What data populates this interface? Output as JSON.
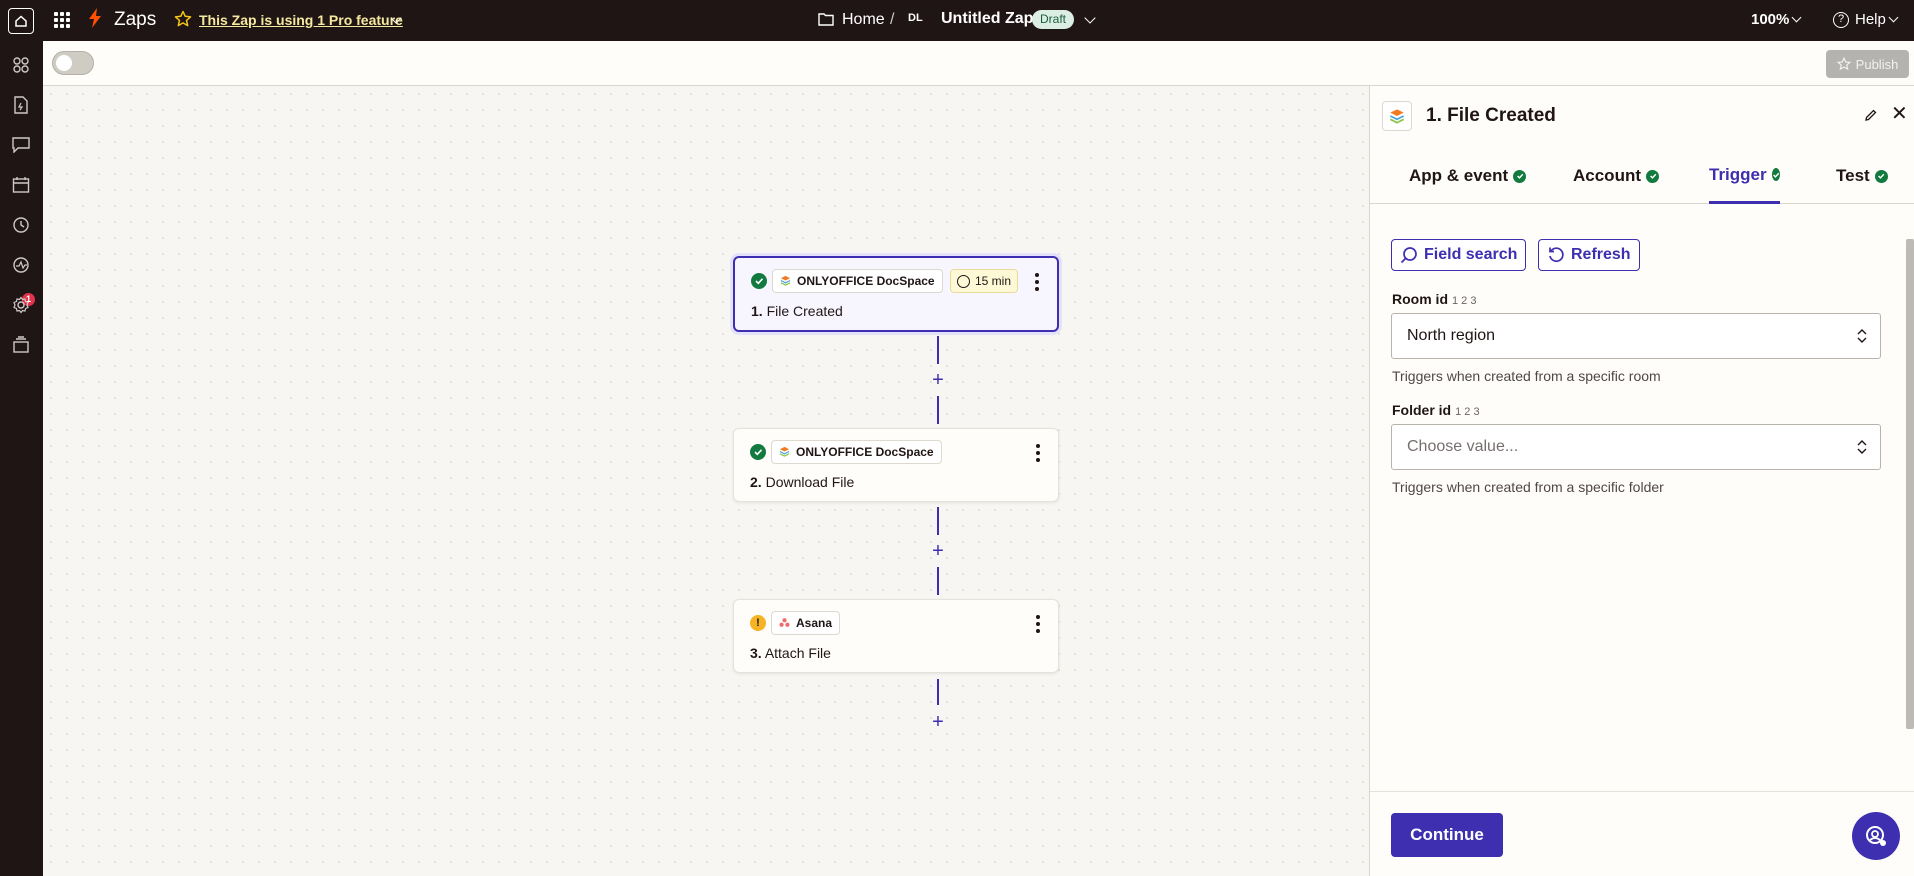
{
  "topbar": {
    "app_name": "Zaps",
    "pro_notice": "This Zap is using 1 Pro feature",
    "breadcrumb_home": "Home",
    "breadcrumb_sep": "/",
    "owner_initials": "DL",
    "zap_title": "Untitled Zap",
    "status_badge": "Draft",
    "zoom": "100%",
    "help": "Help"
  },
  "sidebar": {
    "notifications_count": "1"
  },
  "toolbar": {
    "publish_label": "Publish"
  },
  "steps": [
    {
      "app": "ONLYOFFICE DocSpace",
      "number": "1.",
      "title": "File Created",
      "status": "ok",
      "interval": "15 min"
    },
    {
      "app": "ONLYOFFICE DocSpace",
      "number": "2.",
      "title": "Download File",
      "status": "ok"
    },
    {
      "app": "Asana",
      "number": "3.",
      "title": "Attach File",
      "status": "warning"
    }
  ],
  "panel": {
    "title": "1. File Created",
    "tabs": [
      {
        "label": "App & event"
      },
      {
        "label": "Account"
      },
      {
        "label": "Trigger",
        "active": true
      },
      {
        "label": "Test"
      }
    ],
    "field_search_label": "Field search",
    "refresh_label": "Refresh",
    "fields": [
      {
        "label": "Room id",
        "type_hint": "1 2 3",
        "value": "North region",
        "help": "Triggers when created from a specific room"
      },
      {
        "label": "Folder id",
        "type_hint": "1 2 3",
        "placeholder": "Choose value...",
        "help": "Triggers when created from a specific folder"
      }
    ],
    "continue_label": "Continue"
  },
  "colors": {
    "accent": "#3d2fb0",
    "brand_orange": "#ff4f00",
    "success": "#137a3f",
    "warning": "#f5b326",
    "topbar_bg": "#201515"
  }
}
